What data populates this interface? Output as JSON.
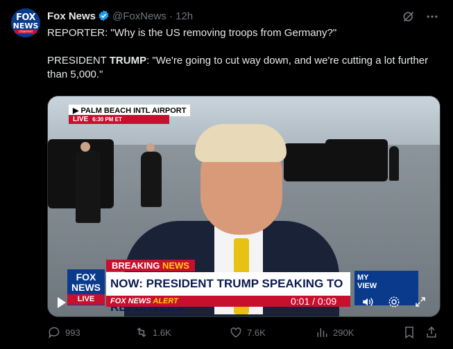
{
  "tweet": {
    "author_name": "Fox News",
    "handle_time": "@FoxNews · 12h",
    "avatar_logo_line1": "FOX",
    "avatar_logo_line2": "NEWS",
    "avatar_logo_line3": "channel",
    "text_line1": "REPORTER: \"Why is the US removing troops from Germany?\"",
    "text_line2_prefix": "PRESIDENT ",
    "text_line2_bold": "TRUMP",
    "text_line2_rest": ": \"We're going to cut way down, and we're cutting a lot further than 5,000.\""
  },
  "video": {
    "location": "PALM BEACH INTL AIRPORT",
    "live_label": "LIVE",
    "live_time": "6:30 PM ET",
    "breaking_label": "BREAKING",
    "breaking_news": "NEWS",
    "headline": "NOW: PRESIDENT TRUMP SPEAKING TO REPORTERS",
    "alert_prefix": "FOX NEWS",
    "alert_word": "ALERT",
    "logo_line1": "FOX",
    "logo_line2": "NEWS",
    "logo_line3": "LIVE",
    "myview_line1": "MY",
    "myview_line2": "VIEW",
    "timecode": "0:01 / 0:09"
  },
  "actions": {
    "replies": "993",
    "reposts": "1.6K",
    "likes": "7.6K",
    "views": "290K"
  },
  "colors": {
    "background": "#000000",
    "text": "#e7e9ea",
    "muted": "#71767b",
    "verified": "#1d9bf0",
    "fox_red": "#c8102e",
    "fox_blue": "#0a3a8c"
  }
}
